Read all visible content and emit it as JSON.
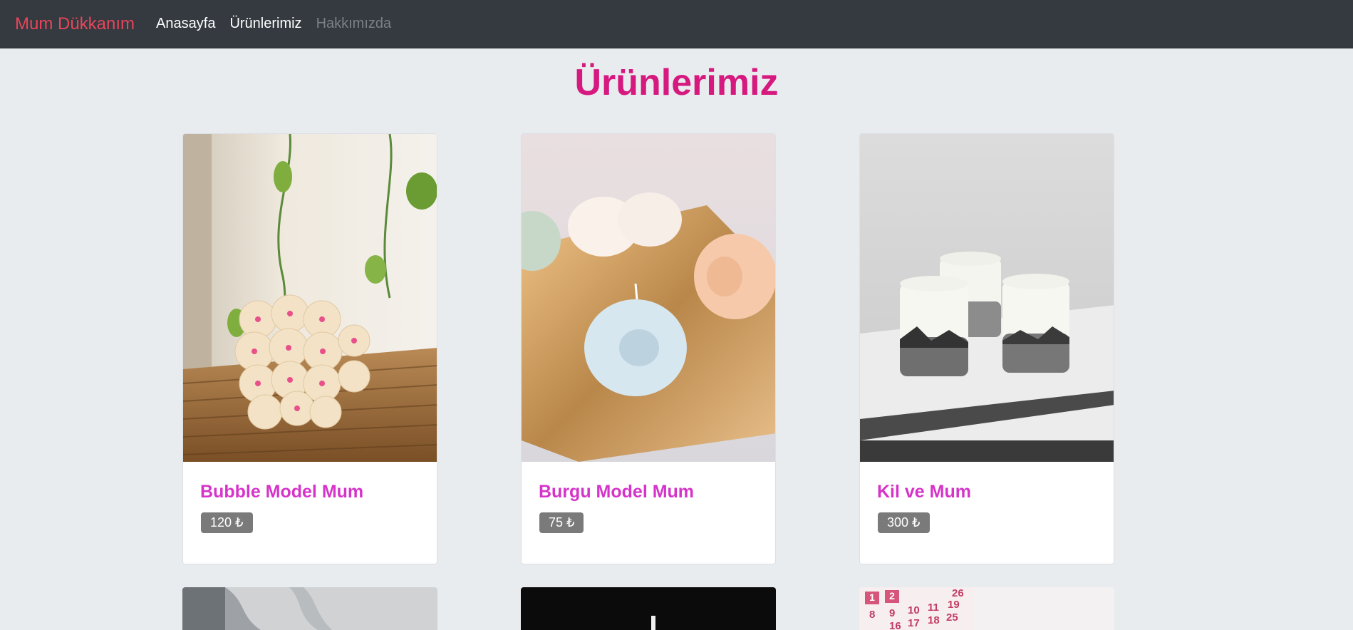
{
  "navbar": {
    "brand": "Mum Dükkanım",
    "links": [
      {
        "label": "Anasayfa",
        "state": "active"
      },
      {
        "label": "Ürünlerimiz",
        "state": "active"
      },
      {
        "label": "Hakkımızda",
        "state": "muted"
      }
    ]
  },
  "page_title": "Ürünlerimiz",
  "products": [
    {
      "name": "Bubble Model Mum",
      "price": "120 ₺",
      "image": "bubble-candle-photo"
    },
    {
      "name": "Burgu Model Mum",
      "price": "75 ₺",
      "image": "knot-candle-photo"
    },
    {
      "name": "Kil ve Mum",
      "price": "300 ₺",
      "image": "concrete-candle-photo"
    }
  ],
  "partial_products": [
    {
      "image": "white-fabric-photo"
    },
    {
      "image": "dark-candle-photo"
    },
    {
      "image": "calendar-photo",
      "calendar_numbers": [
        "1",
        "2",
        "8",
        "9",
        "10",
        "11",
        "16",
        "17",
        "18",
        "19",
        "25",
        "26"
      ]
    }
  ],
  "colors": {
    "navbar_bg": "#343a40",
    "brand": "#e8455a",
    "page_title": "#d6197f",
    "product_title": "#d633c9",
    "price_badge": "#7a7a7a",
    "background": "#e9ecef"
  }
}
